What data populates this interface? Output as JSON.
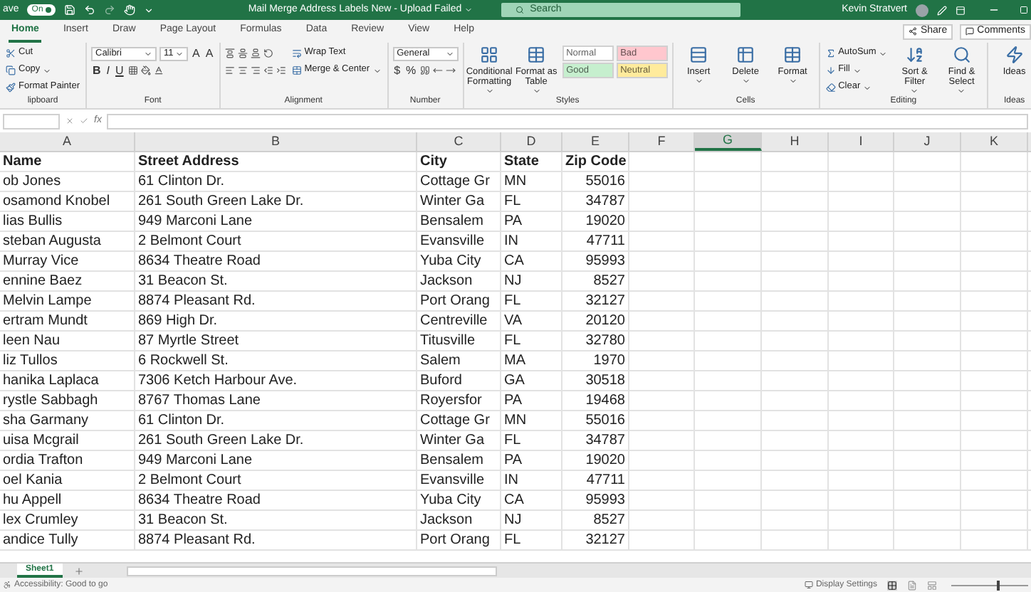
{
  "title_bar": {
    "autosave_label": "ave",
    "autosave_toggle": "On",
    "autosave_on": true,
    "title": "Mail Merge Address Labels New - Upload Failed",
    "search_placeholder": "Search",
    "user": "Kevin Stratvert"
  },
  "tabs": [
    {
      "label": "Home",
      "selected": true
    },
    {
      "label": "Insert",
      "selected": false
    },
    {
      "label": "Draw",
      "selected": false
    },
    {
      "label": "Page Layout",
      "selected": false
    },
    {
      "label": "Formulas",
      "selected": false
    },
    {
      "label": "Data",
      "selected": false
    },
    {
      "label": "Review",
      "selected": false
    },
    {
      "label": "View",
      "selected": false
    },
    {
      "label": "Help",
      "selected": false
    }
  ],
  "share": "Share",
  "comments": "Comments",
  "ribbon_groups": [
    {
      "label": "lipboard",
      "columns": [
        [
          [
            {
              "kind": "small",
              "label": "Cut"
            }
          ],
          [
            {
              "kind": "small",
              "label": "Copy",
              "dropdown": true
            }
          ],
          [
            {
              "kind": "small",
              "label": "Format Painter"
            }
          ]
        ]
      ]
    },
    {
      "label": "Font",
      "columns": [
        [
          [
            {
              "kind": "field",
              "label": "Calibri"
            },
            {
              "kind": "narrow_field",
              "label": "11"
            },
            {
              "kind": "size_glyph",
              "label": "A"
            },
            {
              "kind": "size_glyph",
              "label": "A"
            }
          ],
          [
            {
              "kind": "bold_glyph",
              "label": "B"
            },
            {
              "kind": "italic_glyph",
              "label": "I"
            },
            {
              "kind": "underline_glyph",
              "label": "U"
            },
            {
              "kind": "icon"
            },
            {
              "kind": "icon"
            },
            {
              "kind": "icon"
            }
          ]
        ]
      ]
    },
    {
      "label": "Alignment",
      "columns": [
        [
          [
            {
              "kind": "icon"
            },
            {
              "kind": "icon"
            },
            {
              "kind": "icon"
            },
            {
              "kind": "icon"
            }
          ],
          [
            {
              "kind": "icon"
            },
            {
              "kind": "icon"
            },
            {
              "kind": "icon"
            },
            {
              "kind": "icon"
            },
            {
              "kind": "icon"
            }
          ]
        ],
        [
          [
            {
              "kind": "small",
              "label": "Wrap Text"
            }
          ],
          [
            {
              "kind": "small",
              "label": "Merge & Center",
              "dropdown": true
            }
          ]
        ]
      ]
    },
    {
      "label": "Number",
      "columns": [
        [
          [
            {
              "kind": "field",
              "label": "General"
            }
          ],
          [
            {
              "kind": "currency_glyph",
              "label": "$"
            },
            {
              "kind": "percent_glyph",
              "label": "%"
            },
            {
              "kind": "icon"
            },
            {
              "kind": "icon"
            },
            {
              "kind": "icon"
            }
          ]
        ]
      ]
    },
    {
      "label": "Styles",
      "columns": [
        [
          [
            {
              "kind": "large",
              "label": "Conditional Formatting",
              "dropdown": true
            }
          ]
        ],
        [
          [
            {
              "kind": "large",
              "label": "Format as Table",
              "dropdown": true
            }
          ]
        ],
        [
          [
            {
              "kind": "style",
              "label": "Normal",
              "color": "#ffffff"
            },
            {
              "kind": "style",
              "label": "Bad",
              "color": "#ffc7ce"
            }
          ],
          [
            {
              "kind": "style",
              "label": "Good",
              "color": "#c6efce"
            },
            {
              "kind": "style",
              "label": "Neutral",
              "color": "#ffeb9c"
            }
          ]
        ]
      ]
    },
    {
      "label": "Cells",
      "columns": [
        [
          [
            {
              "kind": "large",
              "label": "Insert",
              "dropdown": true
            }
          ]
        ],
        [
          [
            {
              "kind": "large",
              "label": "Delete",
              "dropdown": true
            }
          ]
        ],
        [
          [
            {
              "kind": "large",
              "label": "Format",
              "dropdown": true
            }
          ]
        ]
      ]
    },
    {
      "label": "Editing",
      "columns": [
        [
          [
            {
              "kind": "small",
              "label": "AutoSum",
              "dropdown": true
            }
          ],
          [
            {
              "kind": "small",
              "label": "Fill",
              "dropdown": true
            }
          ],
          [
            {
              "kind": "small",
              "label": "Clear",
              "dropdown": true
            }
          ]
        ],
        [
          [
            {
              "kind": "large",
              "label": "Sort & Filter",
              "dropdown": true
            }
          ]
        ],
        [
          [
            {
              "kind": "large",
              "label": "Find & Select",
              "dropdown": true
            }
          ]
        ]
      ]
    },
    {
      "label": "Ideas",
      "columns": [
        [
          [
            {
              "kind": "large",
              "label": "Ideas"
            }
          ]
        ]
      ]
    }
  ],
  "formula_bar": {
    "function_label": "fx"
  },
  "columns": [
    {
      "label": "A",
      "selected": false
    },
    {
      "label": "B",
      "selected": false
    },
    {
      "label": "C",
      "selected": false
    },
    {
      "label": "D",
      "selected": false
    },
    {
      "label": "E",
      "selected": false
    },
    {
      "label": "F",
      "selected": false
    },
    {
      "label": "G",
      "selected": true
    },
    {
      "label": "H",
      "selected": false
    },
    {
      "label": "I",
      "selected": false
    },
    {
      "label": "J",
      "selected": false
    },
    {
      "label": "K",
      "selected": false
    }
  ],
  "header_row": [
    "Name",
    "Street Address",
    "City",
    "State",
    "Zip Code"
  ],
  "rows": [
    [
      "ob Jones",
      "61 Clinton Dr.",
      "Cottage Gr",
      "MN",
      "55016"
    ],
    [
      "osamond Knobel",
      "261 South Green Lake Dr.",
      "Winter Ga",
      "FL",
      "34787"
    ],
    [
      "lias Bullis",
      "949 Marconi Lane",
      "Bensalem",
      "PA",
      "19020"
    ],
    [
      "steban Augusta",
      "2 Belmont Court",
      "Evansville",
      "IN",
      "47711"
    ],
    [
      "Murray Vice",
      "8634 Theatre Road",
      "Yuba City",
      "CA",
      "95993"
    ],
    [
      "ennine Baez",
      "31 Beacon St.",
      "Jackson",
      "NJ",
      "8527"
    ],
    [
      "Melvin Lampe",
      "8874 Pleasant Rd.",
      "Port Orang",
      "FL",
      "32127"
    ],
    [
      "ertram Mundt",
      "869 High Dr.",
      "Centreville",
      "VA",
      "20120"
    ],
    [
      "leen Nau",
      "87 Myrtle Street",
      "Titusville",
      "FL",
      "32780"
    ],
    [
      "liz Tullos",
      "6 Rockwell St.",
      "Salem",
      "MA",
      "1970"
    ],
    [
      "hanika Laplaca",
      "7306 Ketch Harbour Ave.",
      "Buford",
      "GA",
      "30518"
    ],
    [
      "rystle Sabbagh",
      "8767 Thomas Lane",
      "Royersfor",
      "PA",
      "19468"
    ],
    [
      "sha Garmany",
      "61 Clinton Dr.",
      "Cottage Gr",
      "MN",
      "55016"
    ],
    [
      "uisa Mcgrail",
      "261 South Green Lake Dr.",
      "Winter Ga",
      "FL",
      "34787"
    ],
    [
      "ordia Trafton",
      "949 Marconi Lane",
      "Bensalem",
      "PA",
      "19020"
    ],
    [
      "oel Kania",
      "2 Belmont Court",
      "Evansville",
      "IN",
      "47711"
    ],
    [
      "hu Appell",
      "8634 Theatre Road",
      "Yuba City",
      "CA",
      "95993"
    ],
    [
      "lex Crumley",
      "31 Beacon St.",
      "Jackson",
      "NJ",
      "8527"
    ],
    [
      "andice Tully",
      "8874 Pleasant Rd.",
      "Port Orang",
      "FL",
      "32127"
    ]
  ],
  "sheet_tabs": [
    {
      "label": "Sheet1",
      "selected": true
    }
  ],
  "status_bar": {
    "accessibility": "Accessibility: Good to go",
    "display_settings": "Display Settings",
    "views": [
      {
        "selected": true
      },
      {
        "selected": false
      },
      {
        "selected": false
      }
    ],
    "zoom": {
      "level": 0.6
    }
  }
}
